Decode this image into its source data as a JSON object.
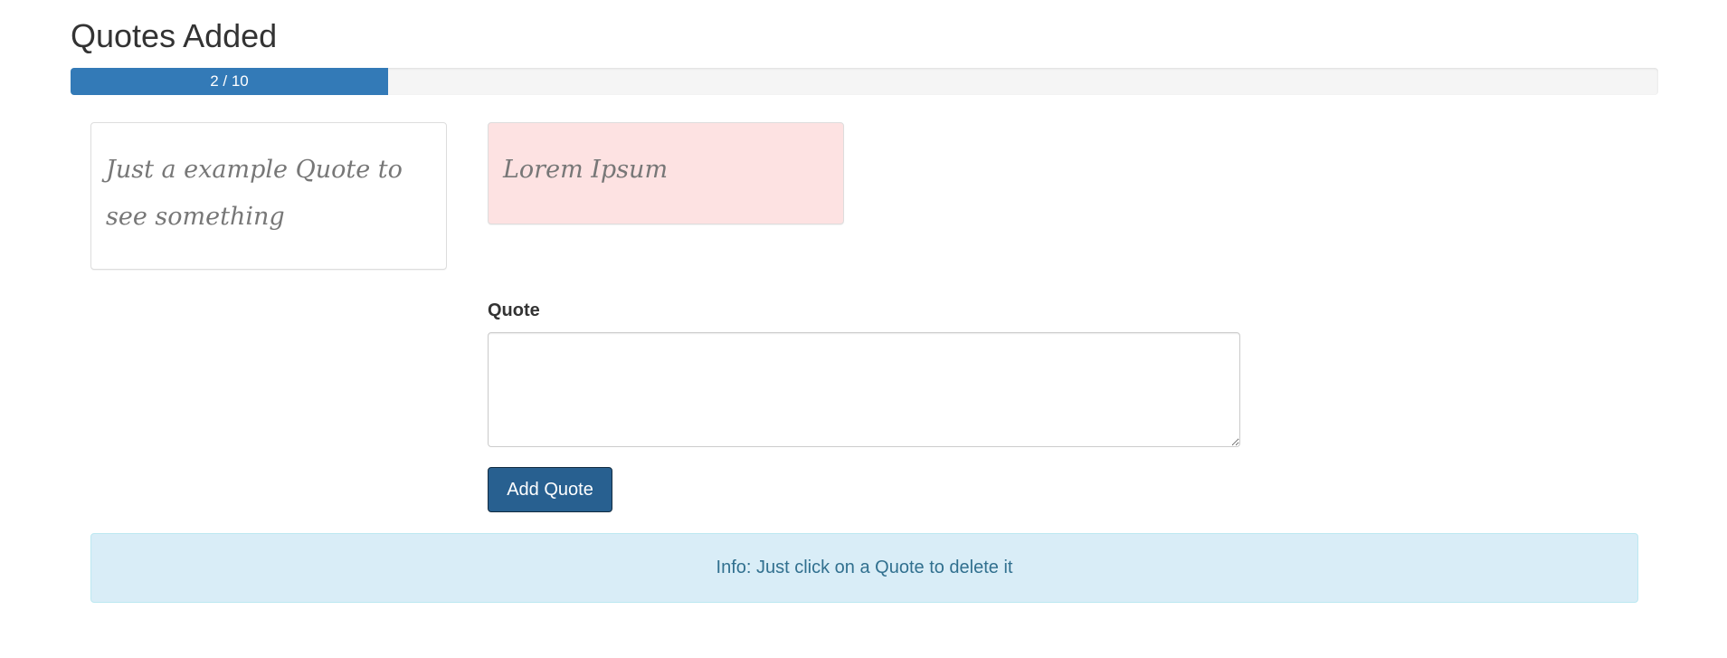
{
  "header": {
    "title": "Quotes Added"
  },
  "progress": {
    "label": "2 / 10",
    "current": 2,
    "total": 10,
    "fraction": 0.2,
    "color": "#337ab7"
  },
  "quotes": [
    {
      "text": "Just a example Quote to see something",
      "background": "#ffffff"
    },
    {
      "text": "Lorem Ipsum",
      "background": "#fde2e2"
    }
  ],
  "form": {
    "quote_label": "Quote",
    "quote_value": "",
    "add_button_label": "Add Quote",
    "button_color": "#286090"
  },
  "info": {
    "message": "Info: Just click on a Quote to delete it",
    "background": "#d9edf7",
    "text_color": "#31708f"
  }
}
